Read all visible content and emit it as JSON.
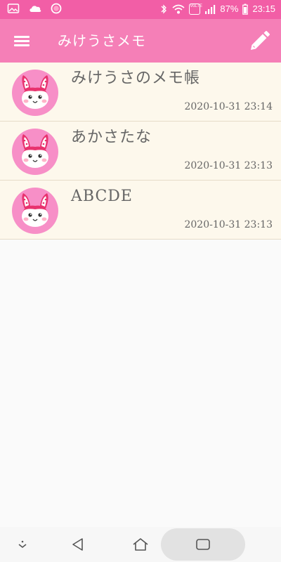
{
  "status_bar": {
    "battery": "87%",
    "time": "23:15",
    "network_badge": "VoLTE",
    "icons": [
      "image-icon",
      "cloud-icon",
      "record-icon",
      "bluetooth-icon",
      "wifi-icon",
      "volte-icon",
      "signal-icon",
      "battery-icon"
    ]
  },
  "app_bar": {
    "title": "みけうさメモ",
    "menu_icon": "hamburger-menu-icon",
    "action_icon": "pencil-edit-icon"
  },
  "memos": [
    {
      "title": "みけうさのメモ帳",
      "date": "2020-10-31 23:14",
      "avatar": "bunny-avatar-icon"
    },
    {
      "title": "あかさたな",
      "date": "2020-10-31 23:13",
      "avatar": "bunny-avatar-icon"
    },
    {
      "title": "ABCDE",
      "date": "2020-10-31 23:13",
      "avatar": "bunny-avatar-icon"
    }
  ],
  "nav_bar": {
    "icons": [
      "hide-keyboard-icon",
      "back-icon",
      "home-icon",
      "recents-icon"
    ]
  },
  "colors": {
    "status_bar": "#f25ea6",
    "app_bar": "#f57fb7",
    "list_background": "#fdf8ec",
    "text": "#666666",
    "avatar_circle": "#f78fc7"
  }
}
